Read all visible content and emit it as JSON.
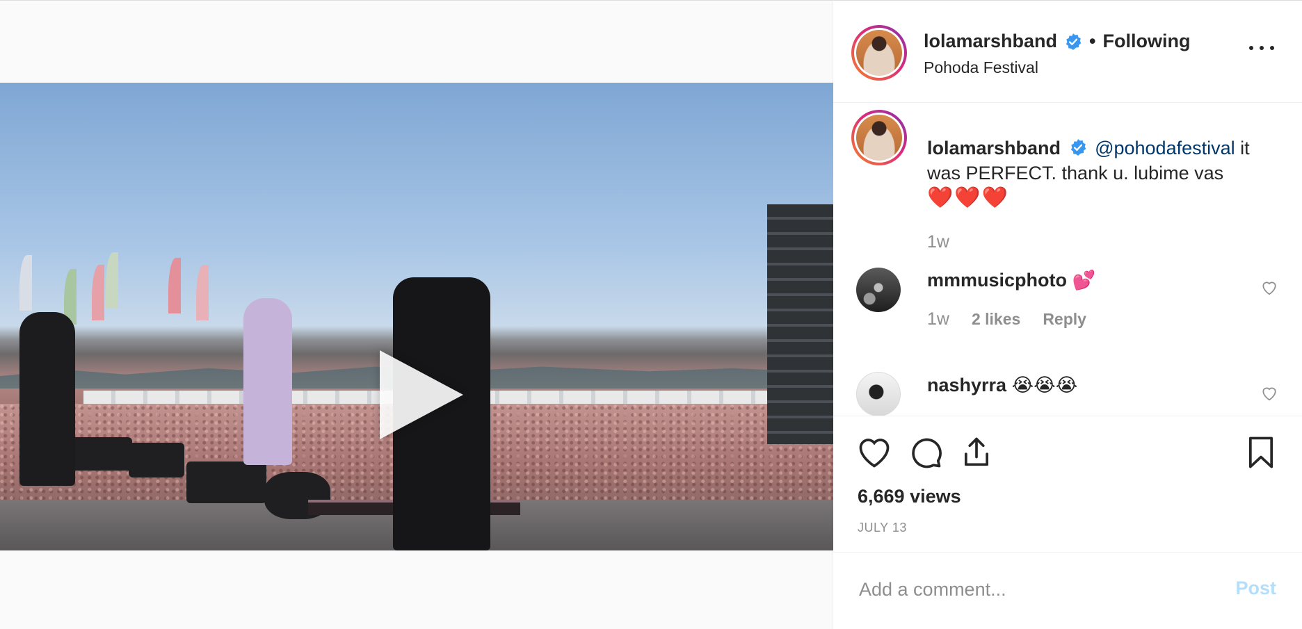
{
  "header": {
    "username": "lolamarshband",
    "separator": "•",
    "follow_status": "Following",
    "location": "Pohoda Festival"
  },
  "caption": {
    "username": "lolamarshband",
    "mention": "@pohodafestival",
    "text": " it was PERFECT. thank u. lubime vas",
    "hearts": "❤️❤️❤️",
    "time": "1w"
  },
  "comments": [
    {
      "username": "mmmusicphoto",
      "text": "💕",
      "time": "1w",
      "likes": "2 likes",
      "reply": "Reply"
    },
    {
      "username": "nashyrra",
      "text": "😭😭😭"
    }
  ],
  "stats": {
    "views": "6,669 views",
    "date": "JULY 13"
  },
  "add_comment": {
    "placeholder": "Add a comment...",
    "post_label": "Post"
  },
  "colors": {
    "verified": "#3897f0",
    "mention": "#00376b",
    "post_disabled": "#b2dffc",
    "muted": "#8e8e8e"
  },
  "icons": {
    "like": "heart-outline-icon",
    "comment": "speech-bubble-icon",
    "share": "share-upload-icon",
    "save": "bookmark-icon",
    "more": "more-dots-icon",
    "play": "play-icon",
    "tags": "user-tag-icon"
  }
}
